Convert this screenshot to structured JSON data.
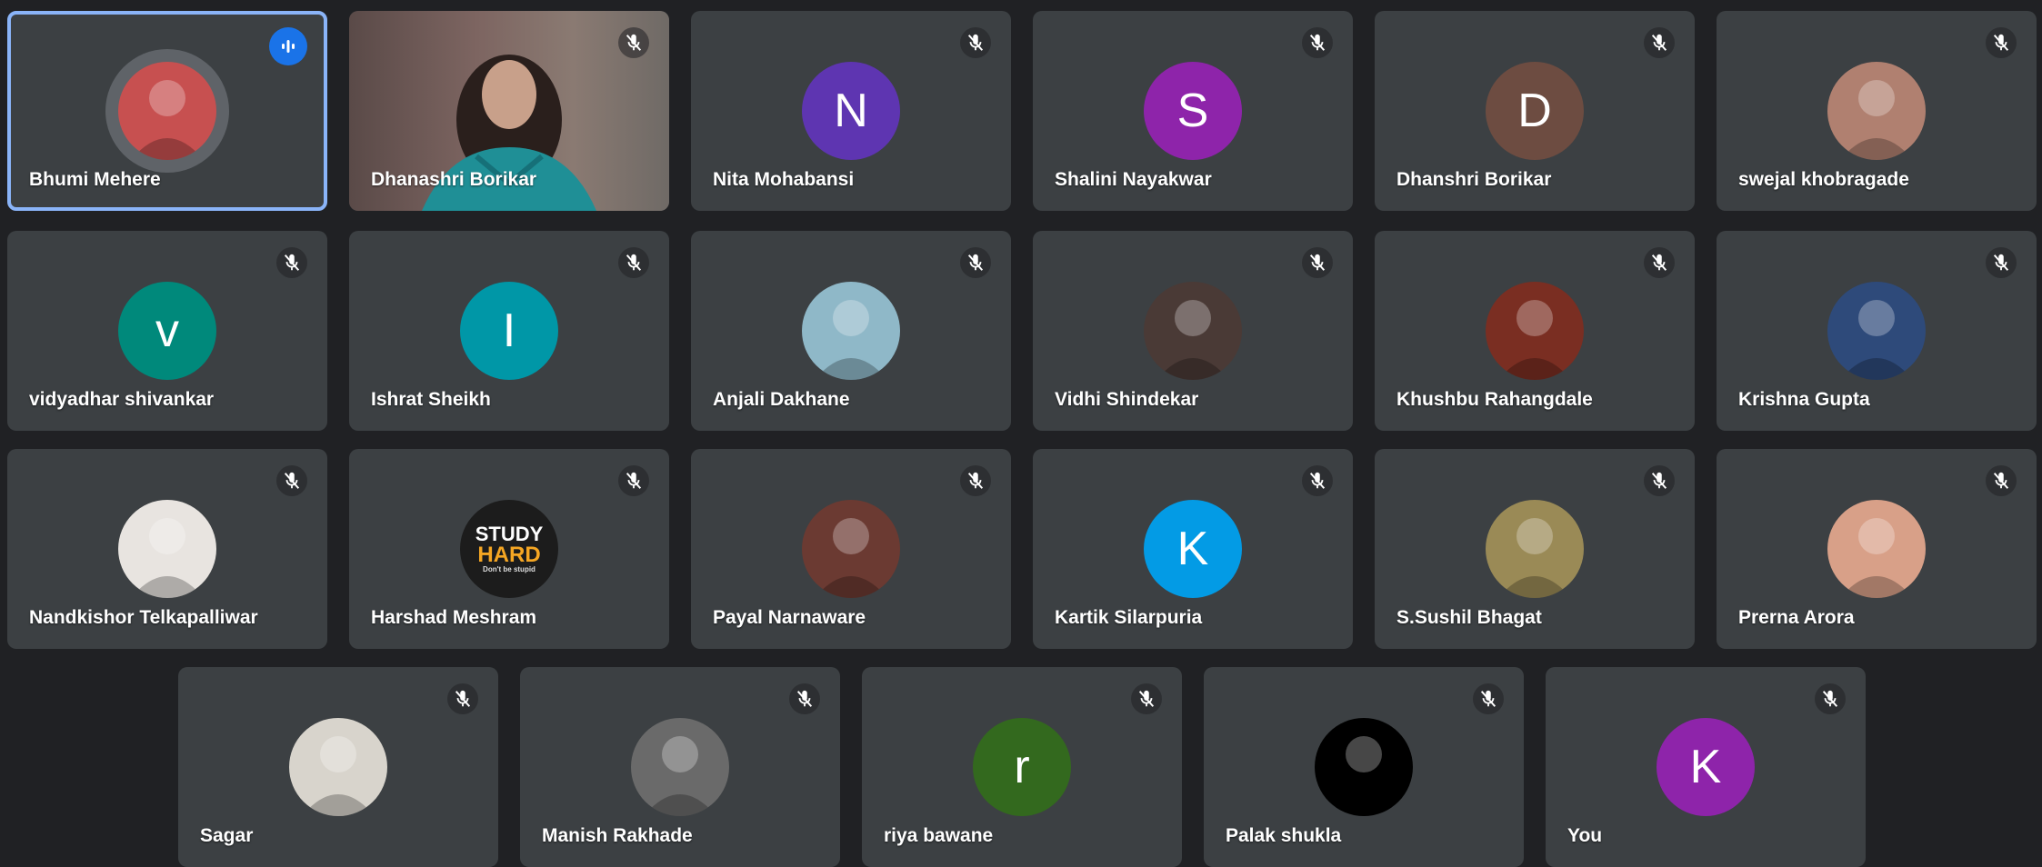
{
  "meeting": {
    "colors": {
      "background": "#202124",
      "tile": "#3c4043",
      "speaking_outline": "#8ab4f8",
      "speaking_badge": "#1a73e8"
    },
    "participants": [
      {
        "name": "Bhumi Mehere",
        "avatar_type": "photo",
        "avatar_color": "#c75050",
        "speaking": true,
        "muted": false
      },
      {
        "name": "Dhanashri Borikar",
        "avatar_type": "video",
        "speaking": false,
        "muted": true
      },
      {
        "name": "Nita Mohabansi",
        "avatar_type": "initial",
        "initial": "N",
        "avatar_color": "#5e35b1",
        "muted": true
      },
      {
        "name": "Shalini Nayakwar",
        "avatar_type": "initial",
        "initial": "S",
        "avatar_color": "#8e24aa",
        "muted": true
      },
      {
        "name": "Dhanshri Borikar",
        "avatar_type": "initial",
        "initial": "D",
        "avatar_color": "#6d4c41",
        "muted": true
      },
      {
        "name": "swejal khobragade",
        "avatar_type": "photo",
        "avatar_color": "#b08070",
        "muted": true
      },
      {
        "name": "vidyadhar shivankar",
        "avatar_type": "initial",
        "initial": "v",
        "avatar_color": "#00897b",
        "muted": true
      },
      {
        "name": "Ishrat Sheikh",
        "avatar_type": "initial",
        "initial": "I",
        "avatar_color": "#0097a7",
        "muted": true
      },
      {
        "name": "Anjali Dakhane",
        "avatar_type": "photo",
        "avatar_color": "#8fb8c8",
        "muted": true
      },
      {
        "name": "Vidhi Shindekar",
        "avatar_type": "photo",
        "avatar_color": "#4a3a36",
        "muted": true
      },
      {
        "name": "Khushbu Rahangdale",
        "avatar_type": "photo",
        "avatar_color": "#7a2e22",
        "muted": true
      },
      {
        "name": "Krishna Gupta",
        "avatar_type": "photo",
        "avatar_color": "#2e4a7a",
        "muted": true
      },
      {
        "name": "Nandkishor Telkapalliwar",
        "avatar_type": "photo",
        "avatar_color": "#e8e4e0",
        "muted": true
      },
      {
        "name": "Harshad Meshram",
        "avatar_type": "photo",
        "avatar_color": "#1c1c1c",
        "muted": true
      },
      {
        "name": "Payal Narnaware",
        "avatar_type": "photo",
        "avatar_color": "#6b3a32",
        "muted": true
      },
      {
        "name": "Kartik Silarpuria",
        "avatar_type": "initial",
        "initial": "K",
        "avatar_color": "#039be5",
        "muted": true
      },
      {
        "name": "S.Sushil Bhagat",
        "avatar_type": "photo",
        "avatar_color": "#9a8a56",
        "muted": true
      },
      {
        "name": "Prerna Arora",
        "avatar_type": "photo",
        "avatar_color": "#d8a088",
        "muted": true
      },
      {
        "name": "Sagar",
        "avatar_type": "photo",
        "avatar_color": "#d8d4cc",
        "muted": true
      },
      {
        "name": "Manish Rakhade",
        "avatar_type": "photo",
        "avatar_color": "#6a6a6a",
        "muted": true
      },
      {
        "name": "riya bawane",
        "avatar_type": "initial",
        "initial": "r",
        "avatar_color": "#33691e",
        "muted": true
      },
      {
        "name": "Palak shukla",
        "avatar_type": "photo",
        "avatar_color": "#000000",
        "muted": true
      },
      {
        "name": "You",
        "avatar_type": "initial",
        "initial": "K",
        "avatar_color": "#8e24aa",
        "muted": true
      }
    ],
    "study_hard_logo": {
      "line1": "STUDY",
      "line2": "HARD",
      "line3": "Don't be stupid"
    }
  }
}
